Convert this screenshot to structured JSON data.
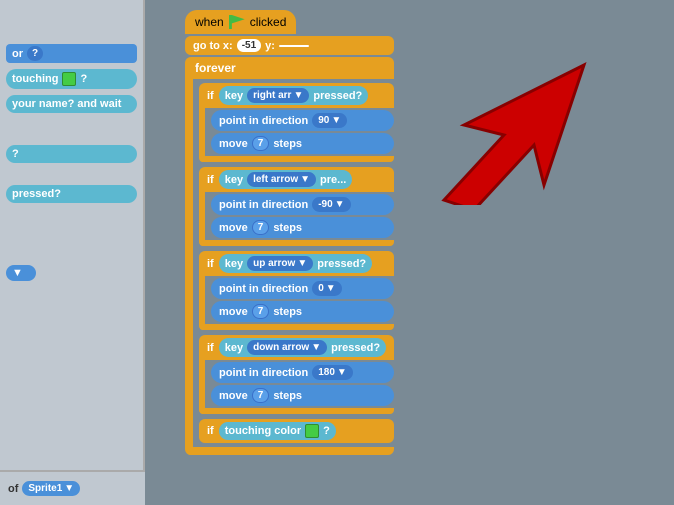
{
  "sidebar": {
    "blocks": [
      {
        "label": "or",
        "type": "blue",
        "id": "or-block"
      },
      {
        "label": "touching",
        "type": "sensing",
        "color": "green",
        "id": "touching-block"
      },
      {
        "label": "your name? and wait",
        "type": "sensing",
        "id": "name-wait-block"
      },
      {
        "label": "?",
        "type": "sensing",
        "id": "question-block"
      },
      {
        "label": "pressed?",
        "type": "sensing",
        "id": "pressed-block"
      },
      {
        "label": "▼",
        "type": "blue",
        "id": "dropdown-block"
      }
    ]
  },
  "main": {
    "hat_block": "when  clicked",
    "go_to": "go to x:",
    "x_val": "-51",
    "y_label": "y:",
    "forever": "forever",
    "if_blocks": [
      {
        "condition_key": "key",
        "key_val": "right arr",
        "pressed": "pressed?",
        "action1_label": "point in direction",
        "action1_val": "90",
        "action2_label": "move",
        "action2_val": "7",
        "action2_suffix": "steps"
      },
      {
        "condition_key": "key",
        "key_val": "left arrow",
        "pressed": "pre...",
        "action1_label": "point in direction",
        "action1_val": "-90",
        "action2_label": "move",
        "action2_val": "7",
        "action2_suffix": "steps"
      },
      {
        "condition_key": "key",
        "key_val": "up arrow",
        "pressed": "pressed?",
        "action1_label": "point in direction",
        "action1_val": "0",
        "action2_label": "move",
        "action2_val": "7",
        "action2_suffix": "steps"
      },
      {
        "condition_key": "key",
        "key_val": "down arrow",
        "pressed": "pressed?",
        "action1_label": "point in direction",
        "action1_val": "180",
        "action2_label": "move",
        "action2_val": "7",
        "action2_suffix": "steps"
      }
    ],
    "last_if": {
      "label": "if",
      "sensing": "touching color",
      "color": "green",
      "question": "?"
    }
  },
  "sprite_panel": {
    "prefix": "of",
    "sprite_name": "Sprite1"
  },
  "arrow": {
    "visible": true
  }
}
